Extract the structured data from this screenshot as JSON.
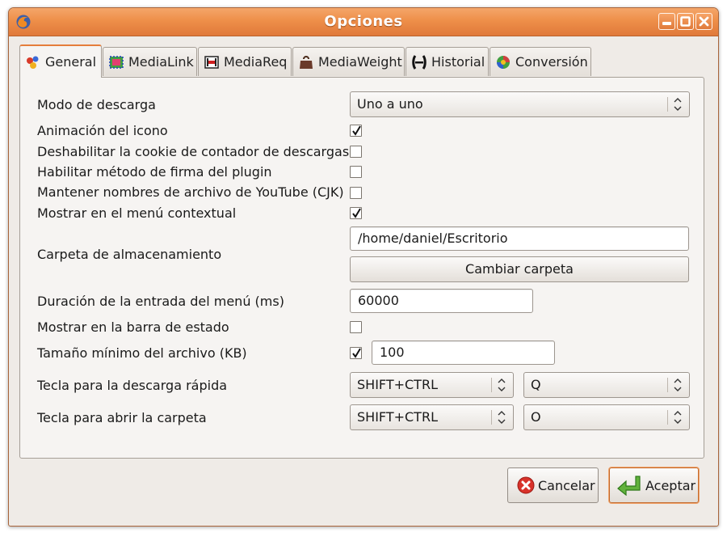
{
  "window": {
    "title": "Opciones"
  },
  "tabs": [
    {
      "label": "General",
      "active": true
    },
    {
      "label": "MediaLink",
      "active": false
    },
    {
      "label": "MediaReq",
      "active": false
    },
    {
      "label": "MediaWeight",
      "active": false
    },
    {
      "label": "Historial",
      "active": false
    },
    {
      "label": "Conversión",
      "active": false
    }
  ],
  "general": {
    "download_mode": {
      "label": "Modo de descarga",
      "value": "Uno a uno"
    },
    "icon_animation": {
      "label": "Animación del icono",
      "checked": true
    },
    "disable_counter_cookie": {
      "label": "Deshabilitar la cookie de contador de descargas",
      "checked": false
    },
    "plugin_signature": {
      "label": "Habilitar método de firma del plugin",
      "checked": false
    },
    "youtube_cjk": {
      "label": "Mantener nombres de archivo de YouTube (CJK)",
      "checked": false
    },
    "context_menu": {
      "label": "Mostrar en el menú contextual",
      "checked": true
    },
    "storage_folder": {
      "label": "Carpeta de almacenamiento",
      "value": "/home/daniel/Escritorio",
      "button": "Cambiar carpeta"
    },
    "menu_duration": {
      "label": "Duración de la entrada del menú (ms)",
      "value": "60000"
    },
    "status_bar": {
      "label": "Mostrar en la barra de estado",
      "checked": false
    },
    "min_size": {
      "label": "Tamaño mínimo del archivo (KB)",
      "checked": true,
      "value": "100"
    },
    "quick_download_key": {
      "label": "Tecla para la descarga rápida",
      "modifier": "SHIFT+CTRL",
      "key": "Q"
    },
    "open_folder_key": {
      "label": "Tecla para abrir la carpeta",
      "modifier": "SHIFT+CTRL",
      "key": "O"
    }
  },
  "buttons": {
    "cancel": "Cancelar",
    "accept": "Aceptar"
  },
  "colors": {
    "titlebar": "#ee8f49",
    "accent": "#e57d3a",
    "dialog_bg": "#efebe7"
  }
}
